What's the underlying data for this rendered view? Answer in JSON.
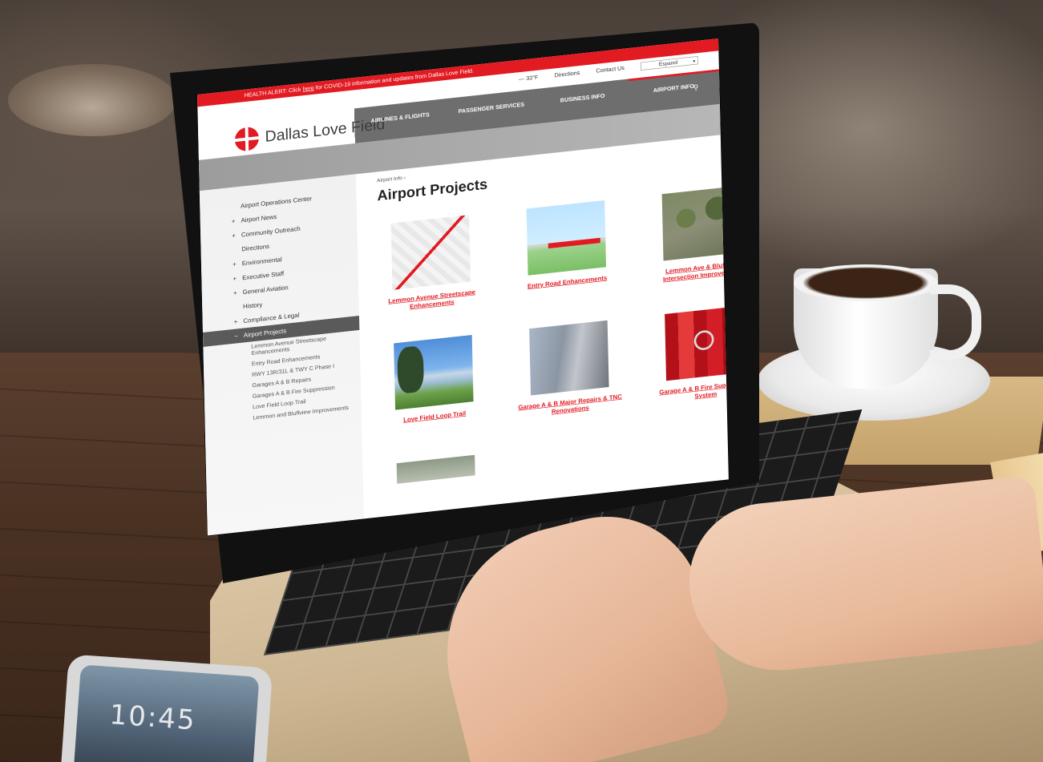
{
  "phone": {
    "time": "10:45"
  },
  "website": {
    "alert": {
      "prefix": "HEALTH ALERT: Click",
      "link": "here",
      "suffix": "for COVID-19 information and updates from Dallas Love Field."
    },
    "utility": {
      "weather": "— 33°F",
      "directions": "Directions",
      "contact": "Contact Us",
      "language": "Espanol"
    },
    "logo_text": "Dallas Love Field",
    "nav": [
      {
        "label": "AIRLINES & FLIGHTS"
      },
      {
        "label": "PASSENGER SERVICES"
      },
      {
        "label": "BUSINESS INFO"
      },
      {
        "label": "AIRPORT INFO"
      }
    ],
    "sidebar": {
      "items": [
        {
          "label": "Airport Operations Center",
          "prefix": ""
        },
        {
          "label": "Airport News",
          "prefix": "+"
        },
        {
          "label": "Community Outreach",
          "prefix": "+"
        },
        {
          "label": "Directions",
          "prefix": ""
        },
        {
          "label": "Environmental",
          "prefix": "+"
        },
        {
          "label": "Executive Staff",
          "prefix": "+"
        },
        {
          "label": "General Aviation",
          "prefix": "+"
        },
        {
          "label": "History",
          "prefix": ""
        },
        {
          "label": "Compliance & Legal",
          "prefix": "+"
        },
        {
          "label": "Airport Projects",
          "prefix": "−"
        }
      ],
      "subitems": [
        {
          "label": "Lemmon Avenue Streetscape Enhancements"
        },
        {
          "label": "Entry Road Enhancements"
        },
        {
          "label": "RWY 13R/31L & TWY C Phase I"
        },
        {
          "label": "Garages A & B Repairs"
        },
        {
          "label": "Garages A & B Fire Suppression"
        },
        {
          "label": "Love Field Loop Trail"
        },
        {
          "label": "Lemmon and Bluffview Improvements"
        }
      ]
    },
    "breadcrumb": "Airport Info ›",
    "page_title": "Airport Projects",
    "projects": [
      {
        "title": "Lemmon Avenue Streetscape Enhancements"
      },
      {
        "title": "Entry Road Enhancements"
      },
      {
        "title": "Lemmon Ave & Bluffview Intersection Improvements"
      },
      {
        "title": "Love Field Loop Trail"
      },
      {
        "title": "Garage A & B Major Repairs & TNC Renovations"
      },
      {
        "title": "Garage A & B Fire Suppression System"
      }
    ]
  },
  "colors": {
    "brand_red": "#e21b23",
    "nav_gray": "#6e6e6e",
    "sidebar_active": "#5a5a5a"
  }
}
